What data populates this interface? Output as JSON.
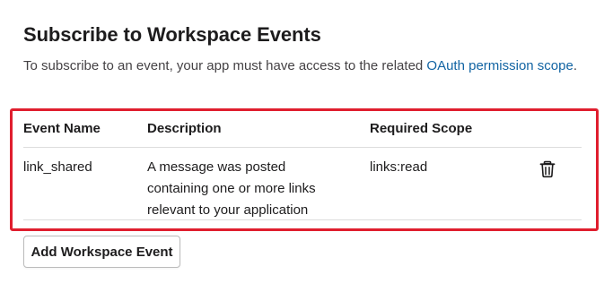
{
  "section": {
    "title": "Subscribe to Workspace Events",
    "intro_text": "To subscribe to an event, your app must have access to the related ",
    "intro_link": "OAuth permission scope",
    "intro_end": "."
  },
  "table": {
    "headers": {
      "event_name": "Event Name",
      "description": "Description",
      "required_scope": "Required Scope"
    },
    "rows": [
      {
        "event_name": "link_shared",
        "description": "A message was posted containing one or more links relevant to your application",
        "required_scope": "links:read",
        "delete_icon": "trash-icon"
      }
    ]
  },
  "actions": {
    "add_button_label": "Add Workspace Event"
  },
  "colors": {
    "link": "#1264a3",
    "highlight_border": "#e01e2e",
    "text": "#1d1c1d"
  }
}
